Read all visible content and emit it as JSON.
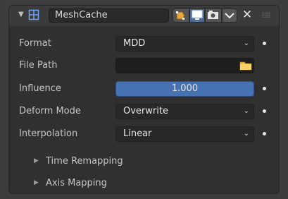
{
  "modifier": {
    "name": "MeshCache",
    "icon": "mesh-cache-icon",
    "header_buttons": [
      "edit-mode-icon",
      "realtime-display-icon",
      "render-icon",
      "modifier-menu-chevron-icon"
    ],
    "accent": "#4772b3"
  },
  "fields": {
    "format": {
      "label": "Format",
      "value": "MDD"
    },
    "file_path": {
      "label": "File Path",
      "value": ""
    },
    "influence": {
      "label": "Influence",
      "value": "1.000"
    },
    "deform_mode": {
      "label": "Deform Mode",
      "value": "Overwrite"
    },
    "interpolation": {
      "label": "Interpolation",
      "value": "Linear"
    }
  },
  "subpanels": {
    "time_remapping": "Time Remapping",
    "axis_mapping": "Axis Mapping"
  }
}
